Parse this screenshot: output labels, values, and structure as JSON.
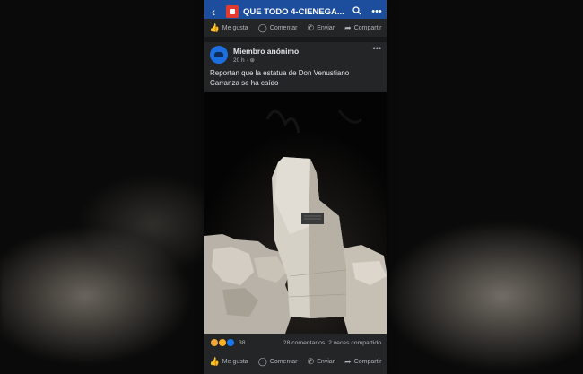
{
  "header": {
    "group_name": "QUE TODO 4-CIENEGA..."
  },
  "top_actions": {
    "like": "Me gusta",
    "comment": "Comentar",
    "send": "Enviar",
    "share": "Compartir"
  },
  "post": {
    "author": "Miembro anónimo",
    "time": "20 h",
    "text": "Reportan que la estatua de Don Venustiano Carranza se ha caído",
    "reaction_count": "38",
    "comments": "28 comentarios",
    "shares": "2 veces compartido"
  },
  "bottom_actions": {
    "like": "Me gusta",
    "comment": "Comentar",
    "send": "Enviar",
    "share": "Compartir"
  },
  "colors": {
    "topbar": "#1d4e9e",
    "panel": "#242526",
    "text_primary": "#e4e6eb",
    "text_secondary": "#b0b3b8"
  },
  "icons": [
    "back-icon",
    "search-icon",
    "more-icon",
    "like-icon",
    "comment-icon",
    "send-icon",
    "share-icon",
    "globe-icon"
  ]
}
